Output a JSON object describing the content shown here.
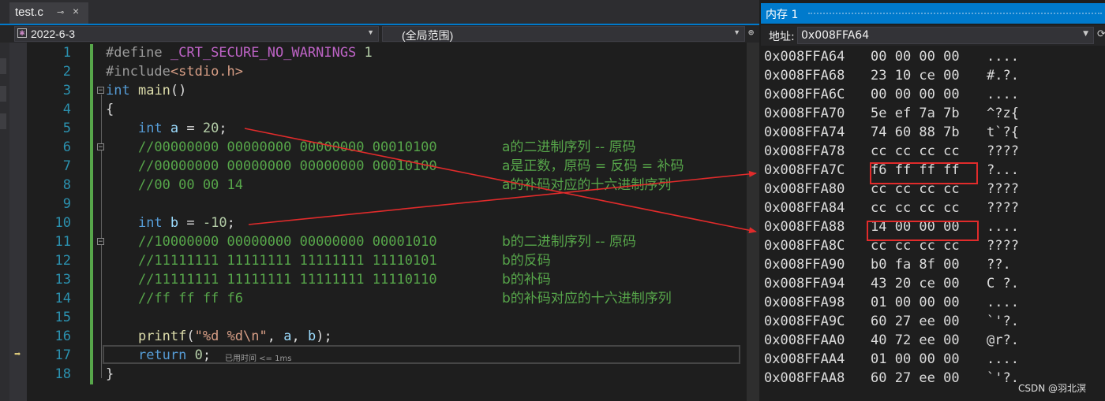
{
  "editor": {
    "tab_title": "test.c",
    "tab_pin": "⊸",
    "tab_close": "×",
    "scope_combo": "2022-6-3",
    "function_combo": "(全局范围)",
    "elapsed": "已用时间 <= 1ms",
    "line_numbers": [
      "1",
      "2",
      "3",
      "4",
      "5",
      "6",
      "7",
      "8",
      "9",
      "10",
      "11",
      "12",
      "13",
      "14",
      "15",
      "16",
      "17",
      "18"
    ],
    "comments_zh": {
      "l6": "a的二进制序列 -- 原码",
      "l7": "a是正数，原码 = 反码 = 补码",
      "l8": "a的补码对应的十六进制序列",
      "l11": "b的二进制序列 -- 原码",
      "l12": "b的反码",
      "l13": "b的补码",
      "l14": "b的补码对应的十六进制序列"
    }
  },
  "memory": {
    "title": "内存 1",
    "address_label": "地址:",
    "address_value": "0x008FFA64",
    "rows": [
      {
        "addr": "0x008FFA64",
        "hex": "00 00 00 00",
        "chars": "...."
      },
      {
        "addr": "0x008FFA68",
        "hex": "23 10 ce 00",
        "chars": "#.?."
      },
      {
        "addr": "0x008FFA6C",
        "hex": "00 00 00 00",
        "chars": "...."
      },
      {
        "addr": "0x008FFA70",
        "hex": "5e ef 7a 7b",
        "chars": "^?z{"
      },
      {
        "addr": "0x008FFA74",
        "hex": "74 60 88 7b",
        "chars": "t`?{"
      },
      {
        "addr": "0x008FFA78",
        "hex": "cc cc cc cc",
        "chars": "????"
      },
      {
        "addr": "0x008FFA7C",
        "hex": "f6 ff ff ff",
        "chars": "?..."
      },
      {
        "addr": "0x008FFA80",
        "hex": "cc cc cc cc",
        "chars": "????"
      },
      {
        "addr": "0x008FFA84",
        "hex": "cc cc cc cc",
        "chars": "????"
      },
      {
        "addr": "0x008FFA88",
        "hex": "14 00 00 00",
        "chars": "...."
      },
      {
        "addr": "0x008FFA8C",
        "hex": "cc cc cc cc",
        "chars": "????"
      },
      {
        "addr": "0x008FFA90",
        "hex": "b0 fa 8f 00",
        "chars": "??."
      },
      {
        "addr": "0x008FFA94",
        "hex": "43 20 ce 00",
        "chars": "C ?."
      },
      {
        "addr": "0x008FFA98",
        "hex": "01 00 00 00",
        "chars": "...."
      },
      {
        "addr": "0x008FFA9C",
        "hex": "60 27 ee 00",
        "chars": "`'?."
      },
      {
        "addr": "0x008FFAA0",
        "hex": "40 72 ee 00",
        "chars": "@r?."
      },
      {
        "addr": "0x008FFAA4",
        "hex": "01 00 00 00",
        "chars": "...."
      },
      {
        "addr": "0x008FFAA8",
        "hex": "60 27 ee 00",
        "chars": "`'?."
      }
    ]
  },
  "watermark": "CSDN @羽北溟",
  "colors": {
    "accent": "#007acc",
    "highlight_box": "#e12b2b",
    "comment_green": "#57a64a"
  }
}
